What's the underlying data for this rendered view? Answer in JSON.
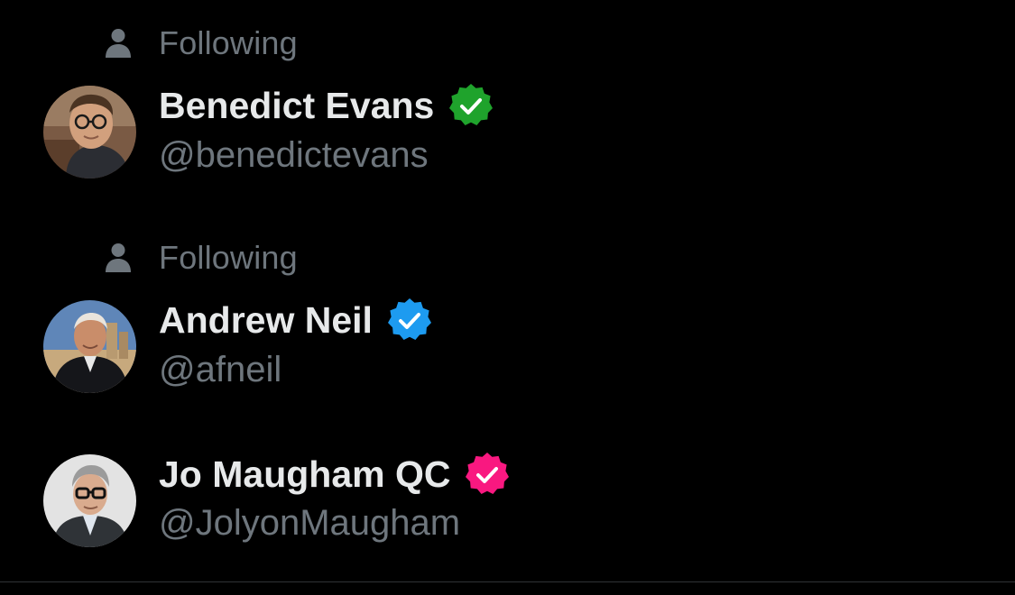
{
  "colors": {
    "background": "#000000",
    "name_text": "#e7e9ea",
    "secondary_text": "#6e767d",
    "badge_green": "#1fa32c",
    "badge_blue": "#1d9bf0",
    "badge_pink": "#f91880"
  },
  "accounts": [
    {
      "social_context": "Following",
      "social_context_icon": "person-icon",
      "display_name": "Benedict Evans",
      "handle": "@benedictevans",
      "badge": "verified-badge-green-icon"
    },
    {
      "social_context": "Following",
      "social_context_icon": "person-icon",
      "display_name": "Andrew Neil",
      "handle": "@afneil",
      "badge": "verified-badge-blue-icon"
    },
    {
      "social_context": "",
      "display_name": "Jo Maugham QC",
      "handle": "@JolyonMaugham",
      "badge": "verified-badge-pink-icon"
    }
  ]
}
